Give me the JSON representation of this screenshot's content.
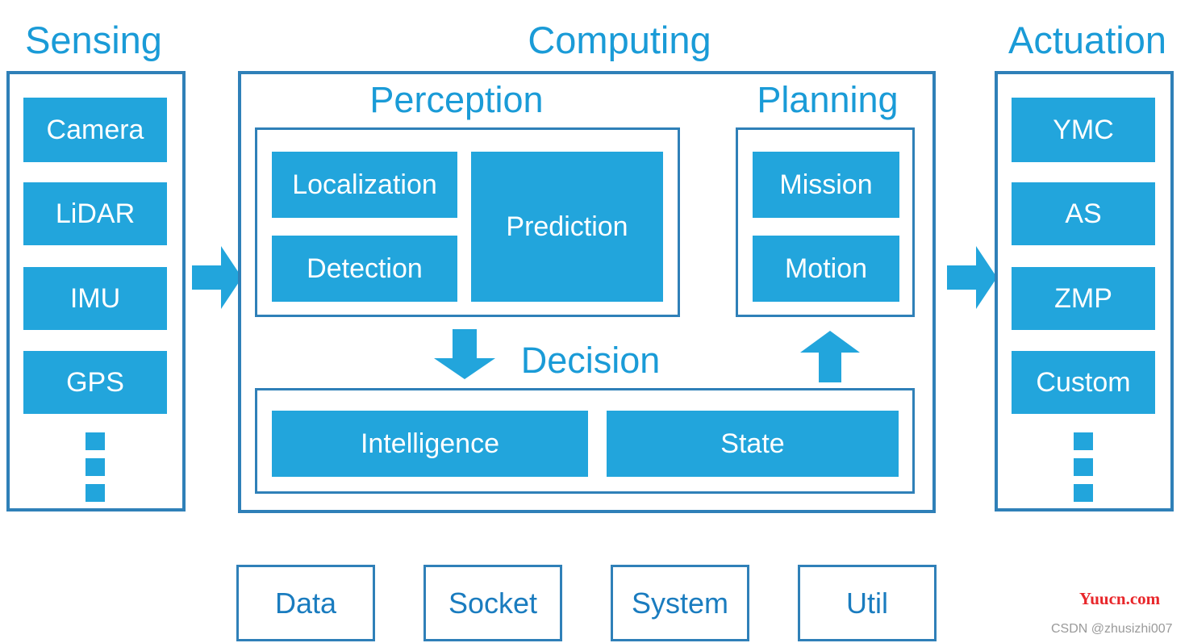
{
  "diagram": {
    "columns": {
      "sensing": {
        "title": "Sensing",
        "items": [
          {
            "label": "Camera"
          },
          {
            "label": "LiDAR"
          },
          {
            "label": "IMU"
          },
          {
            "label": "GPS"
          }
        ],
        "ellipsis": "vertical-dots"
      },
      "computing": {
        "title": "Computing",
        "perception": {
          "title": "Perception",
          "items": [
            {
              "label": "Localization"
            },
            {
              "label": "Detection"
            },
            {
              "label": "Prediction"
            }
          ]
        },
        "planning": {
          "title": "Planning",
          "items": [
            {
              "label": "Mission"
            },
            {
              "label": "Motion"
            }
          ]
        },
        "decision": {
          "title": "Decision",
          "items": [
            {
              "label": "Intelligence"
            },
            {
              "label": "State"
            }
          ]
        }
      },
      "actuation": {
        "title": "Actuation",
        "items": [
          {
            "label": "YMC"
          },
          {
            "label": "AS"
          },
          {
            "label": "ZMP"
          },
          {
            "label": "Custom"
          }
        ],
        "ellipsis": "vertical-dots"
      }
    },
    "bottom_modules": [
      {
        "label": "Data"
      },
      {
        "label": "Socket"
      },
      {
        "label": "System"
      },
      {
        "label": "Util"
      }
    ],
    "arrows": {
      "sensing_to_computing": "arrow-right",
      "computing_to_actuation": "arrow-right",
      "perception_to_decision": "arrow-down",
      "decision_to_planning": "arrow-up"
    },
    "colors": {
      "fill": "#22a5dc",
      "border": "#2f80b8",
      "title": "#1a9bd7",
      "block_text": "#ffffff",
      "bottom_text": "#1a7cbf"
    }
  },
  "watermarks": {
    "site": "Yuucn.com",
    "author": "CSDN @zhusizhi007"
  }
}
